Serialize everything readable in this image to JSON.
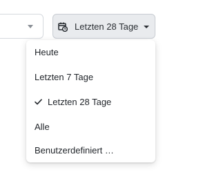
{
  "range_button": {
    "label": "Letzten 28 Tage",
    "icon": "calendar-clock-icon",
    "expanded": true
  },
  "left_select": {
    "icon": "chevron-down-icon"
  },
  "menu": {
    "items": [
      {
        "label": "Heute",
        "selected": false
      },
      {
        "label": "Letzten 7 Tage",
        "selected": false
      },
      {
        "label": "Letzten 28 Tage",
        "selected": true
      },
      {
        "label": "Alle",
        "selected": false
      },
      {
        "label": "Benutzerdefiniert …",
        "selected": false
      }
    ]
  },
  "colors": {
    "button_bg": "#e9ebee",
    "text": "#1f2328",
    "border": "#c8ccd2"
  }
}
